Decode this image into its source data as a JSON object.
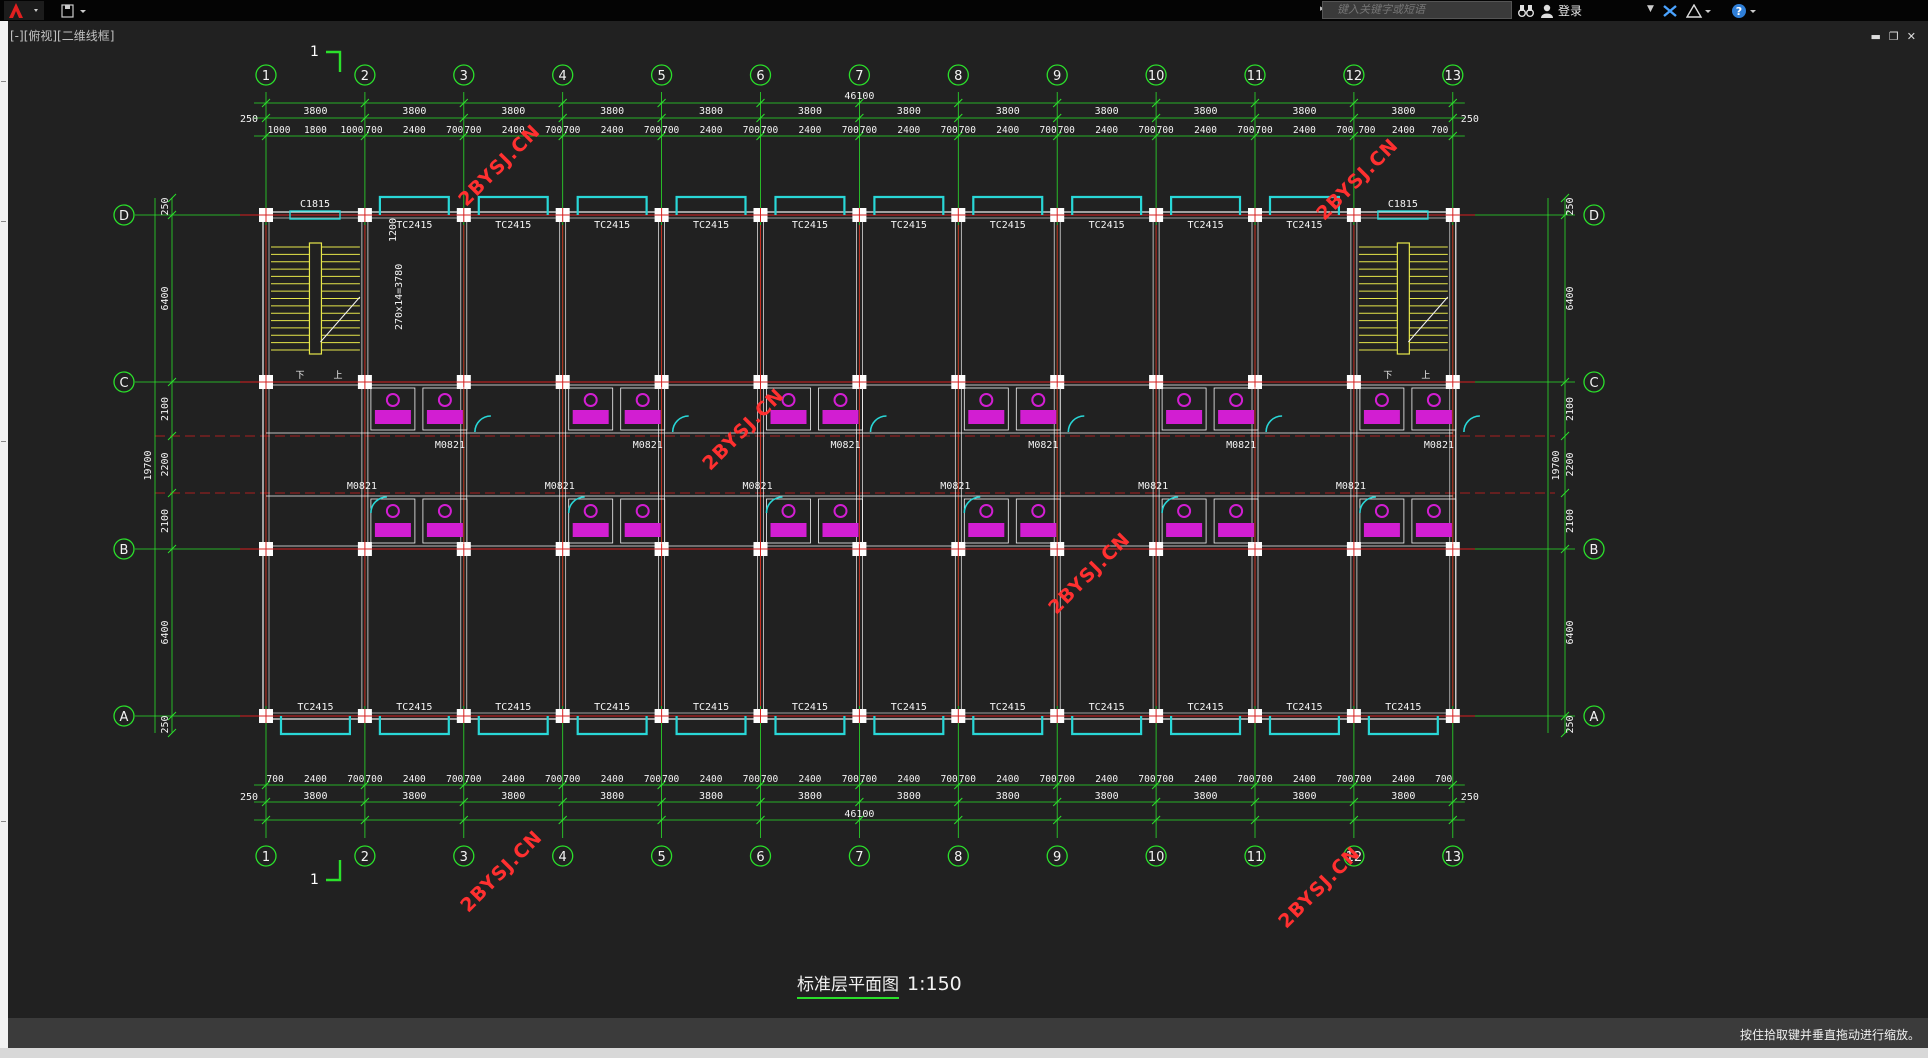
{
  "toolbar": {
    "search_placeholder": "键入关键字或短语",
    "user_label": "登录"
  },
  "viewport_label": "[-][俯视][二维线框]",
  "status_text": "按住拾取键并垂直拖动进行缩放。",
  "drawing": {
    "title": "标准层平面图",
    "scale": "1:150",
    "section_mark": "1",
    "watermark": "2BYSJ.CN",
    "columns": [
      "1",
      "2",
      "3",
      "4",
      "5",
      "6",
      "7",
      "8",
      "9",
      "10",
      "11",
      "12",
      "13"
    ],
    "rows": [
      "D",
      "C",
      "B",
      "A"
    ],
    "overall_length": "46100",
    "bay_top": [
      "3800",
      "3800",
      "3800",
      "3800",
      "3800",
      "3800",
      "3800",
      "3800",
      "3800",
      "3800",
      "3800",
      "3800"
    ],
    "bay_bottom": [
      "3800",
      "3800",
      "3800",
      "3800",
      "3800",
      "3800",
      "3800",
      "3800",
      "3800",
      "3800",
      "3800",
      "3800"
    ],
    "edge_dim": "250",
    "detail_top": [
      "1000",
      "1800",
      "1000",
      "700",
      "2400",
      "700",
      "700",
      "2400",
      "700",
      "700",
      "2400",
      "700",
      "700",
      "2400",
      "700",
      "700",
      "2400",
      "700",
      "700",
      "2400",
      "700",
      "700",
      "2400",
      "700",
      "700",
      "2400",
      "700",
      "700",
      "2400",
      "700",
      "700",
      "2400",
      "700",
      "700",
      "2400",
      "700",
      "1000",
      "1800",
      "1000"
    ],
    "detail_bottom": [
      "700",
      "2400",
      "700",
      "700",
      "2400",
      "700",
      "700",
      "2400",
      "700",
      "700",
      "2400",
      "700",
      "700",
      "2400",
      "700",
      "700",
      "2400",
      "700",
      "700",
      "2400",
      "700",
      "700",
      "2400",
      "700",
      "700",
      "2400",
      "700",
      "700",
      "2400",
      "700",
      "700",
      "2400",
      "700",
      "700",
      "2400",
      "700"
    ],
    "depth_total": "19700",
    "depths": [
      "250",
      "6400",
      "2100",
      "2200",
      "2100",
      "6400",
      "250"
    ],
    "edge_dims_v": [
      "250",
      "250"
    ],
    "window_top": "TC2415",
    "window_stair": "C1815",
    "window_bottom": "TC2415",
    "door": "M0821",
    "stair_note": "270x14=3780",
    "stair_dim": "1200",
    "stair_up": "上",
    "stair_down": "下"
  }
}
